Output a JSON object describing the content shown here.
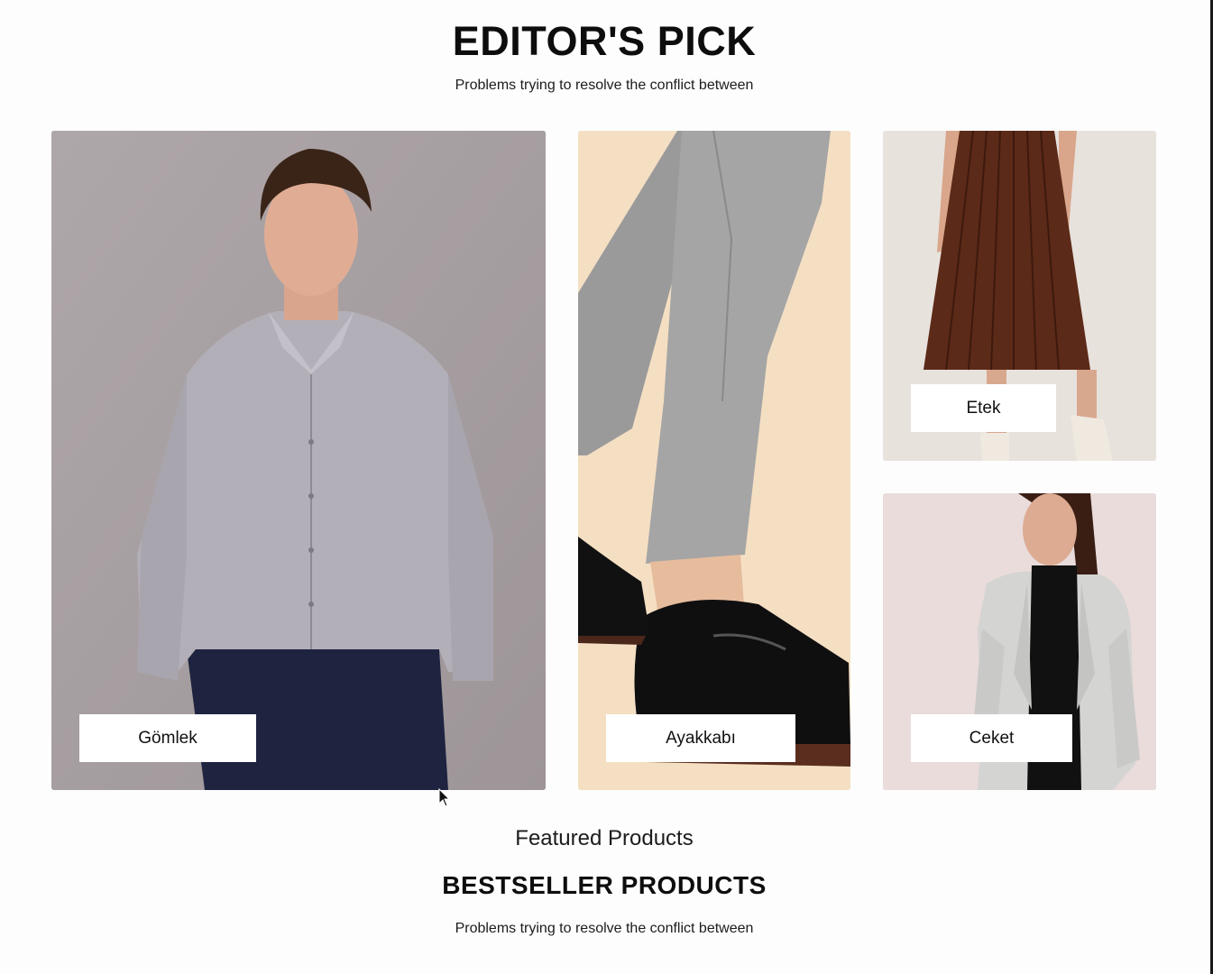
{
  "editors_pick": {
    "title": "EDITOR'S PICK",
    "subtitle": "Problems trying to resolve the conflict between",
    "cards": [
      {
        "label": "Gömlek",
        "image": "man-in-grey-shirt-photo"
      },
      {
        "label": "Ayakkabı",
        "image": "patent-leather-shoes-photo"
      },
      {
        "label": "Etek",
        "image": "pleated-brown-skirt-photo"
      },
      {
        "label": "Ceket",
        "image": "woman-in-tweed-jacket-photo"
      }
    ]
  },
  "featured": {
    "label": "Featured Products",
    "title": "BESTSELLER PRODUCTS",
    "subtitle": "Problems trying to resolve the conflict between"
  },
  "icons": {
    "cursor": "mouse-pointer-icon"
  }
}
